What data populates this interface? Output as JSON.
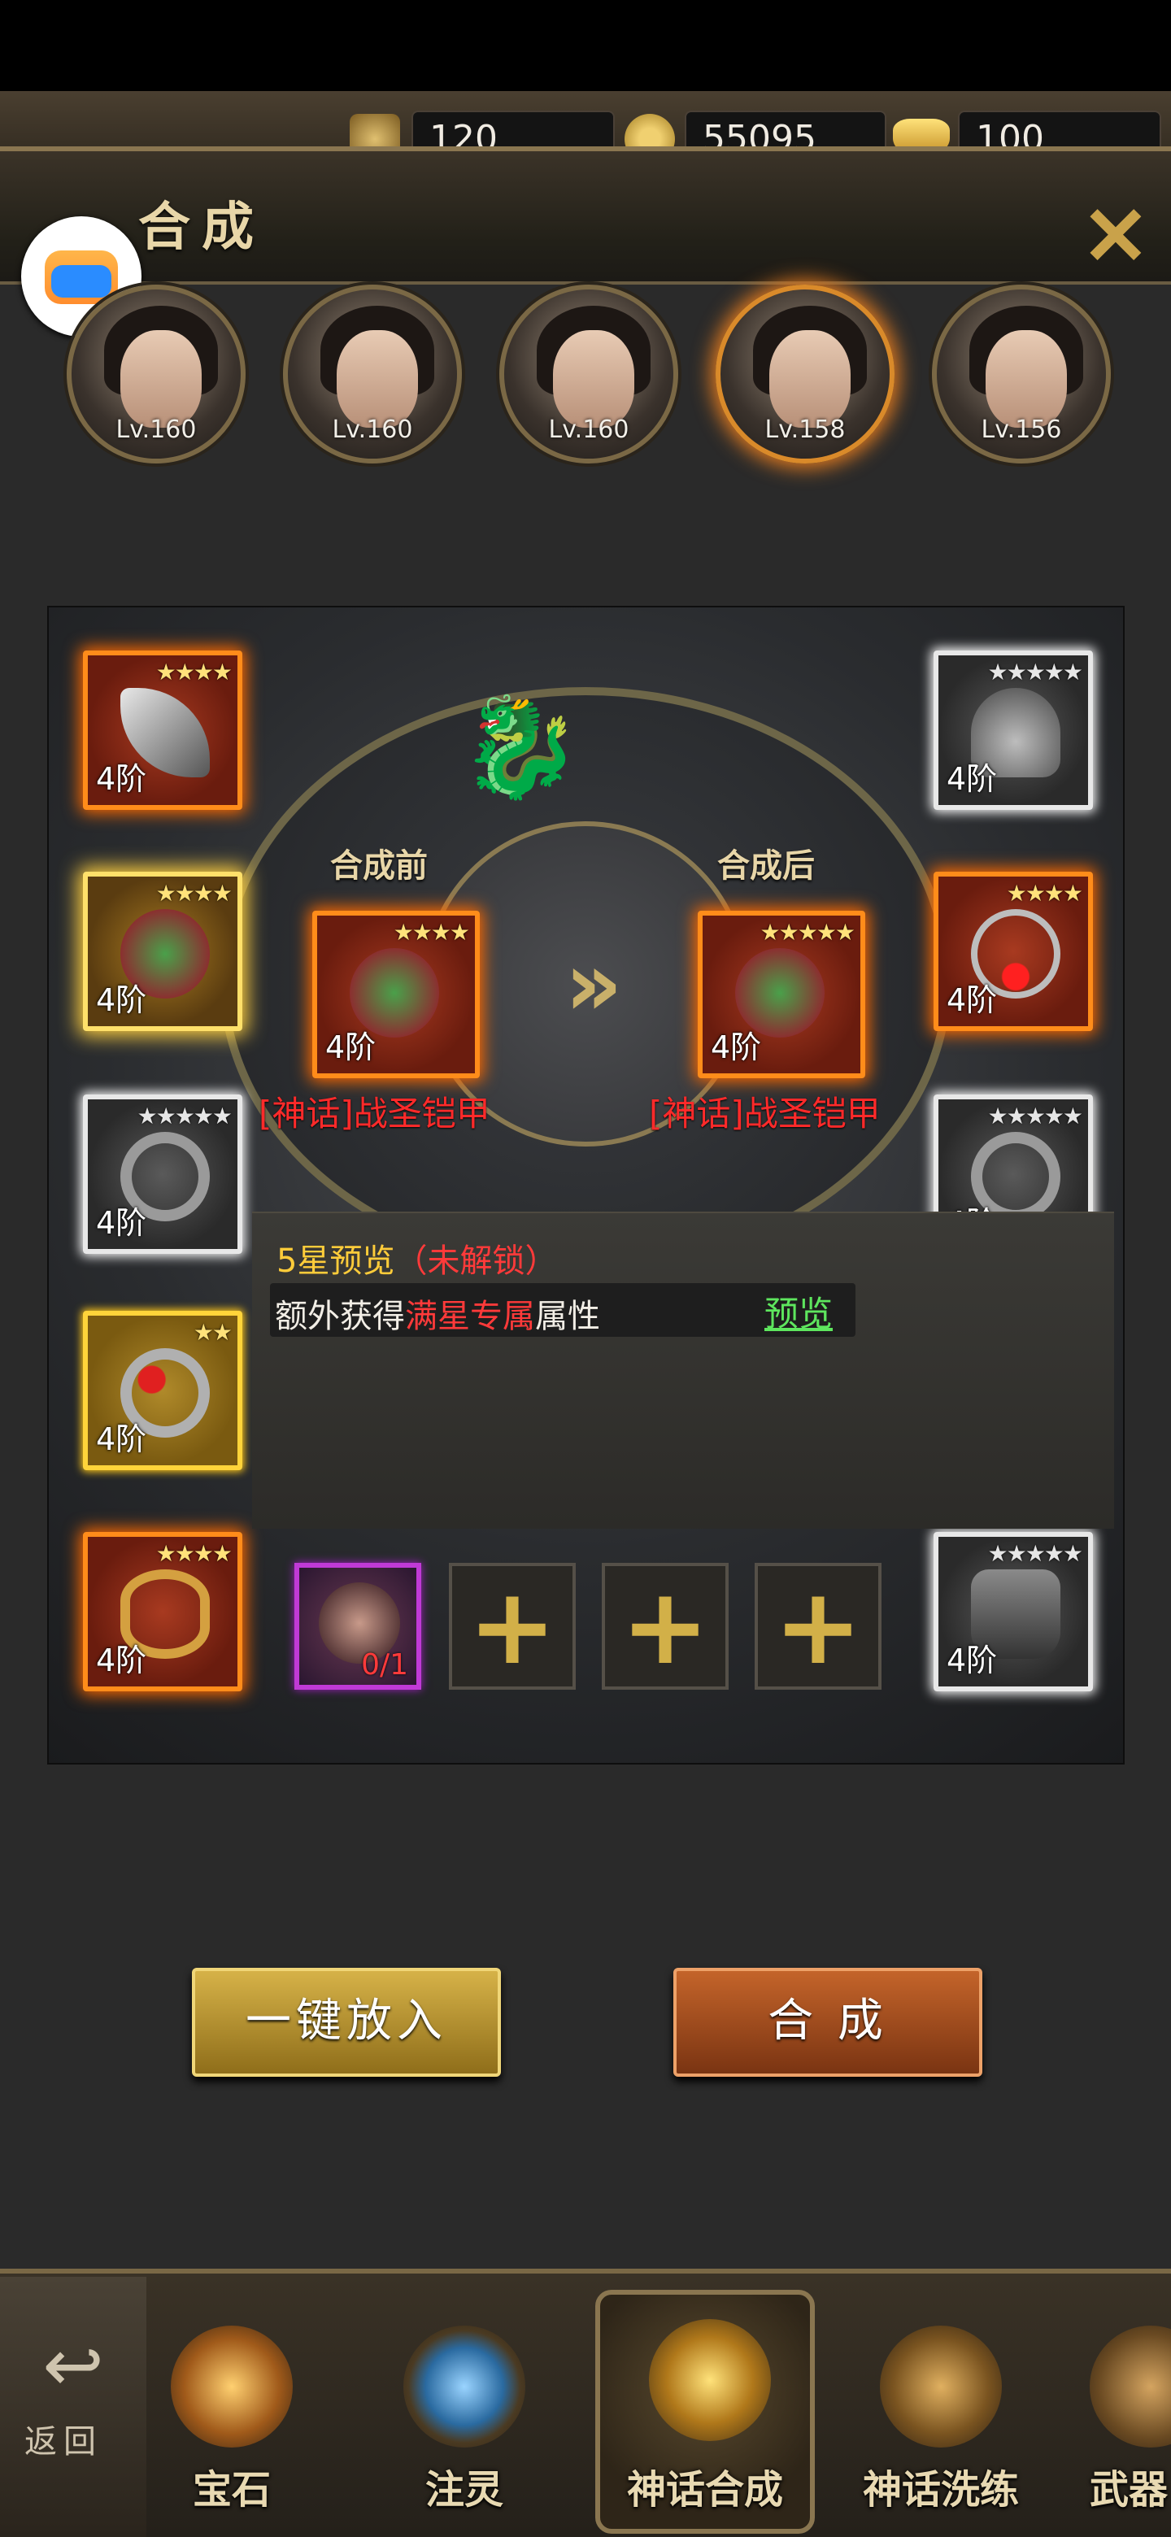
{
  "currency": [
    {
      "icon": "token-icon",
      "value": "120"
    },
    {
      "icon": "copper-coin-icon",
      "value": "55095"
    },
    {
      "icon": "gold-ingot-icon",
      "value": "100"
    }
  ],
  "header": {
    "title": "合成",
    "close_icon": "close-icon"
  },
  "heroes": [
    {
      "level": "Lv.160",
      "selected": false
    },
    {
      "level": "Lv.160",
      "selected": false
    },
    {
      "level": "Lv.160",
      "selected": false
    },
    {
      "level": "Lv.158",
      "selected": true
    },
    {
      "level": "Lv.156",
      "selected": false
    }
  ],
  "equipment_left": [
    {
      "stars": "★★★★",
      "tier": "4阶",
      "icon": "blade-icon",
      "quality": "red"
    },
    {
      "stars": "★★★★",
      "tier": "4阶",
      "icon": "armor-icon",
      "quality": "gold"
    },
    {
      "stars": "★★★★★",
      "tier": "4阶",
      "icon": "ring-icon",
      "quality": "silver"
    },
    {
      "stars": "★★",
      "tier": "4阶",
      "icon": "ring-icon",
      "quality": "yellow"
    },
    {
      "stars": "★★★★",
      "tier": "4阶",
      "icon": "bracelet-icon",
      "quality": "red"
    }
  ],
  "equipment_right": [
    {
      "stars": "★★★★★",
      "tier": "4阶",
      "icon": "helmet-icon",
      "quality": "silver"
    },
    {
      "stars": "★★★★",
      "tier": "4阶",
      "icon": "necklace-icon",
      "quality": "red"
    },
    {
      "stars": "★★★★★",
      "tier": "4阶",
      "icon": "ring-icon",
      "quality": "silver"
    },
    {
      "stars": "★★★★★",
      "tier": "4阶",
      "icon": "ring-icon",
      "quality": "silver"
    },
    {
      "stars": "★★★★★",
      "tier": "4阶",
      "icon": "boots-icon",
      "quality": "silver"
    }
  ],
  "synthesis": {
    "before_label": "合成前",
    "after_label": "合成后",
    "before_item": {
      "name": "[神话]战圣铠甲",
      "stars": "★★★★",
      "tier": "4阶"
    },
    "after_item": {
      "name": "[神话]战圣铠甲",
      "stars": "★★★★★",
      "tier": "4阶"
    }
  },
  "preview": {
    "title": "5星预览",
    "locked": "（未解锁）",
    "line_prefix": "额外获得",
    "line_highlight": "满星专属",
    "line_suffix": "属性",
    "link": "预览"
  },
  "materials": [
    {
      "type": "stone",
      "count": "0/1"
    },
    {
      "type": "empty",
      "plus": "+"
    },
    {
      "type": "empty",
      "plus": "+"
    },
    {
      "type": "empty",
      "plus": "+"
    }
  ],
  "buttons": {
    "auto_fill": "一键放入",
    "synthesize": "合 成"
  },
  "bottom_nav": {
    "back": "返回",
    "tabs": [
      {
        "label": "宝石",
        "selected": false
      },
      {
        "label": "注灵",
        "selected": false
      },
      {
        "label": "神话合成",
        "selected": true
      },
      {
        "label": "神话洗练",
        "selected": false
      },
      {
        "label": "武器",
        "selected": false
      }
    ]
  }
}
